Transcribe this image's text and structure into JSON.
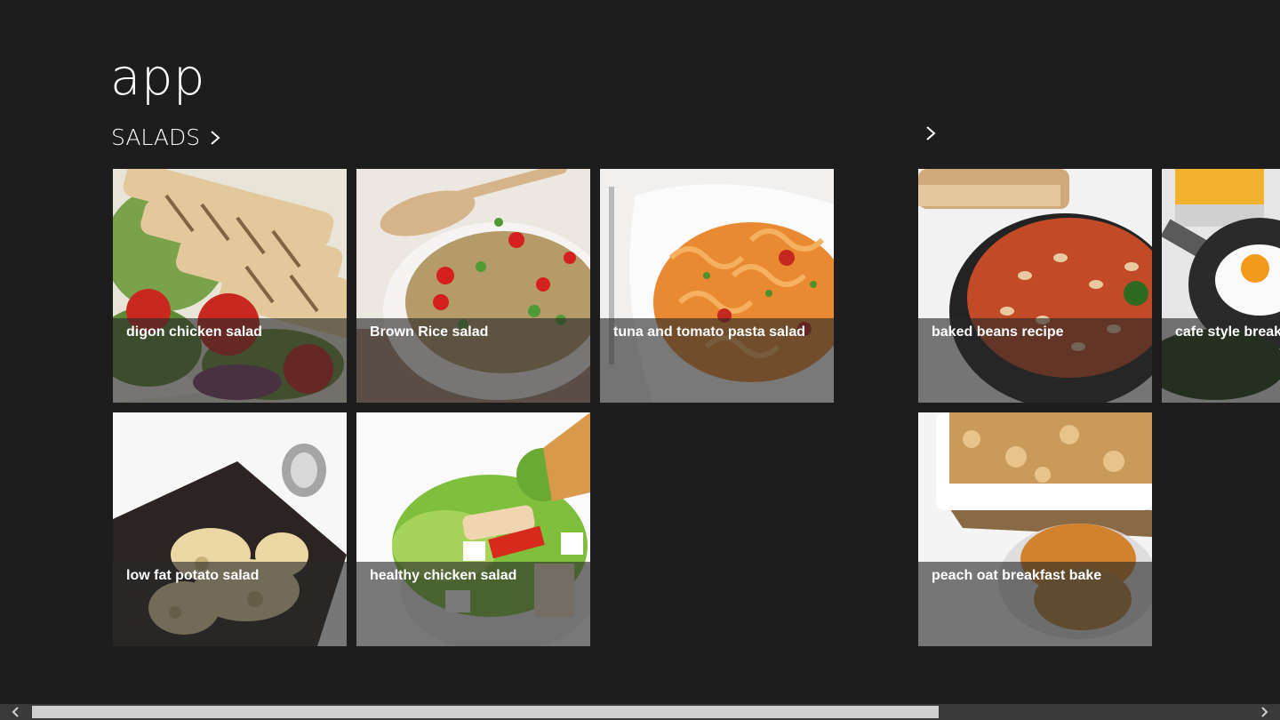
{
  "app": {
    "title": "app"
  },
  "groups": [
    {
      "header": "SALADS"
    },
    {
      "header": ""
    }
  ],
  "tiles": [
    {
      "caption": "digon chicken salad"
    },
    {
      "caption": "Brown Rice salad"
    },
    {
      "caption": "tuna and tomato pasta salad"
    },
    {
      "caption": "low fat potato salad"
    },
    {
      "caption": "healthy chicken salad"
    },
    {
      "caption": "baked beans recipe"
    },
    {
      "caption": "cafe style breakfa"
    },
    {
      "caption": "peach oat breakfast bake"
    }
  ],
  "colors": {
    "background": "#1d1d1d",
    "caption_overlay": "#282828",
    "scroll_thumb": "#cfcfcf"
  }
}
